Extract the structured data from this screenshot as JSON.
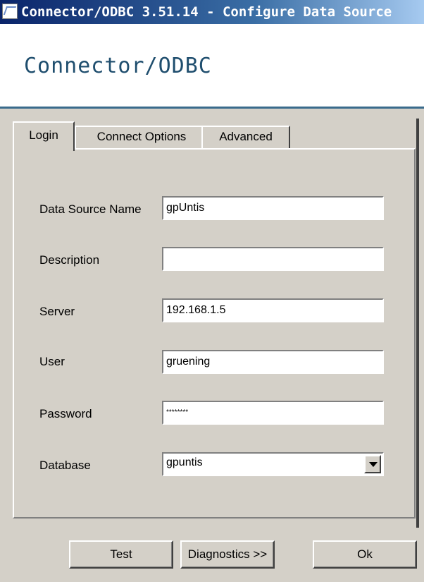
{
  "window": {
    "title": "Connector/ODBC 3.51.14 - Configure Data Source"
  },
  "banner": {
    "product_name": "Connector/ODBC"
  },
  "tabs": [
    {
      "label": "Login",
      "active": true
    },
    {
      "label": "Connect Options",
      "active": false
    },
    {
      "label": "Advanced",
      "active": false
    }
  ],
  "login": {
    "data_source_name": {
      "label": "Data Source Name",
      "value": "gpUntis"
    },
    "description": {
      "label": "Description",
      "value": ""
    },
    "server": {
      "label": "Server",
      "value": "192.168.1.5"
    },
    "user": {
      "label": "User",
      "value": "gruening"
    },
    "password": {
      "label": "Password",
      "value": "********"
    },
    "database": {
      "label": "Database",
      "value": "gpuntis"
    }
  },
  "buttons": {
    "test": "Test",
    "diagnostics": "Diagnostics >>",
    "ok": "Ok"
  }
}
